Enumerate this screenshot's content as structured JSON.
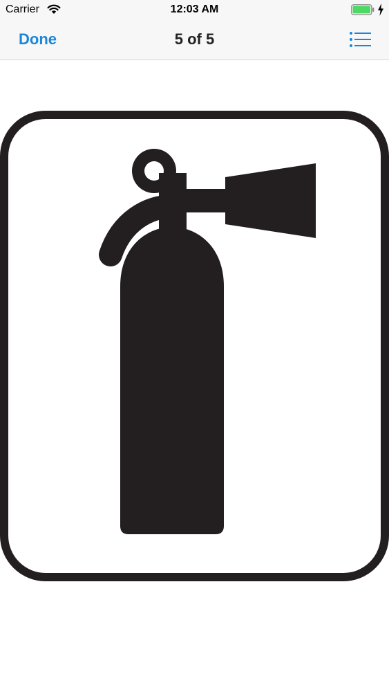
{
  "status_bar": {
    "carrier": "Carrier",
    "time": "12:03 AM",
    "battery_color": "#4cd964"
  },
  "nav_bar": {
    "done_label": "Done",
    "title": "5 of 5",
    "accent_color": "#1a86d9",
    "list_icon": "list-icon"
  },
  "content": {
    "image_icon": "fire-extinguisher-sign"
  }
}
